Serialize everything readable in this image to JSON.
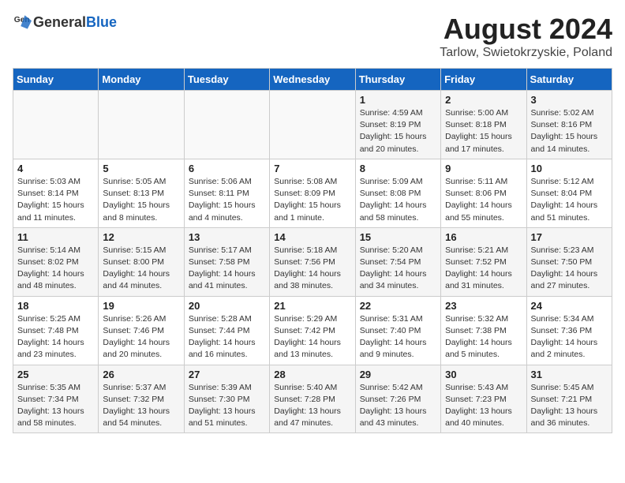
{
  "header": {
    "logo_general": "General",
    "logo_blue": "Blue",
    "month_title": "August 2024",
    "location": "Tarlow, Swietokrzyskie, Poland"
  },
  "weekdays": [
    "Sunday",
    "Monday",
    "Tuesday",
    "Wednesday",
    "Thursday",
    "Friday",
    "Saturday"
  ],
  "weeks": [
    [
      {
        "day": "",
        "info": ""
      },
      {
        "day": "",
        "info": ""
      },
      {
        "day": "",
        "info": ""
      },
      {
        "day": "",
        "info": ""
      },
      {
        "day": "1",
        "info": "Sunrise: 4:59 AM\nSunset: 8:19 PM\nDaylight: 15 hours\nand 20 minutes."
      },
      {
        "day": "2",
        "info": "Sunrise: 5:00 AM\nSunset: 8:18 PM\nDaylight: 15 hours\nand 17 minutes."
      },
      {
        "day": "3",
        "info": "Sunrise: 5:02 AM\nSunset: 8:16 PM\nDaylight: 15 hours\nand 14 minutes."
      }
    ],
    [
      {
        "day": "4",
        "info": "Sunrise: 5:03 AM\nSunset: 8:14 PM\nDaylight: 15 hours\nand 11 minutes."
      },
      {
        "day": "5",
        "info": "Sunrise: 5:05 AM\nSunset: 8:13 PM\nDaylight: 15 hours\nand 8 minutes."
      },
      {
        "day": "6",
        "info": "Sunrise: 5:06 AM\nSunset: 8:11 PM\nDaylight: 15 hours\nand 4 minutes."
      },
      {
        "day": "7",
        "info": "Sunrise: 5:08 AM\nSunset: 8:09 PM\nDaylight: 15 hours\nand 1 minute."
      },
      {
        "day": "8",
        "info": "Sunrise: 5:09 AM\nSunset: 8:08 PM\nDaylight: 14 hours\nand 58 minutes."
      },
      {
        "day": "9",
        "info": "Sunrise: 5:11 AM\nSunset: 8:06 PM\nDaylight: 14 hours\nand 55 minutes."
      },
      {
        "day": "10",
        "info": "Sunrise: 5:12 AM\nSunset: 8:04 PM\nDaylight: 14 hours\nand 51 minutes."
      }
    ],
    [
      {
        "day": "11",
        "info": "Sunrise: 5:14 AM\nSunset: 8:02 PM\nDaylight: 14 hours\nand 48 minutes."
      },
      {
        "day": "12",
        "info": "Sunrise: 5:15 AM\nSunset: 8:00 PM\nDaylight: 14 hours\nand 44 minutes."
      },
      {
        "day": "13",
        "info": "Sunrise: 5:17 AM\nSunset: 7:58 PM\nDaylight: 14 hours\nand 41 minutes."
      },
      {
        "day": "14",
        "info": "Sunrise: 5:18 AM\nSunset: 7:56 PM\nDaylight: 14 hours\nand 38 minutes."
      },
      {
        "day": "15",
        "info": "Sunrise: 5:20 AM\nSunset: 7:54 PM\nDaylight: 14 hours\nand 34 minutes."
      },
      {
        "day": "16",
        "info": "Sunrise: 5:21 AM\nSunset: 7:52 PM\nDaylight: 14 hours\nand 31 minutes."
      },
      {
        "day": "17",
        "info": "Sunrise: 5:23 AM\nSunset: 7:50 PM\nDaylight: 14 hours\nand 27 minutes."
      }
    ],
    [
      {
        "day": "18",
        "info": "Sunrise: 5:25 AM\nSunset: 7:48 PM\nDaylight: 14 hours\nand 23 minutes."
      },
      {
        "day": "19",
        "info": "Sunrise: 5:26 AM\nSunset: 7:46 PM\nDaylight: 14 hours\nand 20 minutes."
      },
      {
        "day": "20",
        "info": "Sunrise: 5:28 AM\nSunset: 7:44 PM\nDaylight: 14 hours\nand 16 minutes."
      },
      {
        "day": "21",
        "info": "Sunrise: 5:29 AM\nSunset: 7:42 PM\nDaylight: 14 hours\nand 13 minutes."
      },
      {
        "day": "22",
        "info": "Sunrise: 5:31 AM\nSunset: 7:40 PM\nDaylight: 14 hours\nand 9 minutes."
      },
      {
        "day": "23",
        "info": "Sunrise: 5:32 AM\nSunset: 7:38 PM\nDaylight: 14 hours\nand 5 minutes."
      },
      {
        "day": "24",
        "info": "Sunrise: 5:34 AM\nSunset: 7:36 PM\nDaylight: 14 hours\nand 2 minutes."
      }
    ],
    [
      {
        "day": "25",
        "info": "Sunrise: 5:35 AM\nSunset: 7:34 PM\nDaylight: 13 hours\nand 58 minutes."
      },
      {
        "day": "26",
        "info": "Sunrise: 5:37 AM\nSunset: 7:32 PM\nDaylight: 13 hours\nand 54 minutes."
      },
      {
        "day": "27",
        "info": "Sunrise: 5:39 AM\nSunset: 7:30 PM\nDaylight: 13 hours\nand 51 minutes."
      },
      {
        "day": "28",
        "info": "Sunrise: 5:40 AM\nSunset: 7:28 PM\nDaylight: 13 hours\nand 47 minutes."
      },
      {
        "day": "29",
        "info": "Sunrise: 5:42 AM\nSunset: 7:26 PM\nDaylight: 13 hours\nand 43 minutes."
      },
      {
        "day": "30",
        "info": "Sunrise: 5:43 AM\nSunset: 7:23 PM\nDaylight: 13 hours\nand 40 minutes."
      },
      {
        "day": "31",
        "info": "Sunrise: 5:45 AM\nSunset: 7:21 PM\nDaylight: 13 hours\nand 36 minutes."
      }
    ]
  ]
}
